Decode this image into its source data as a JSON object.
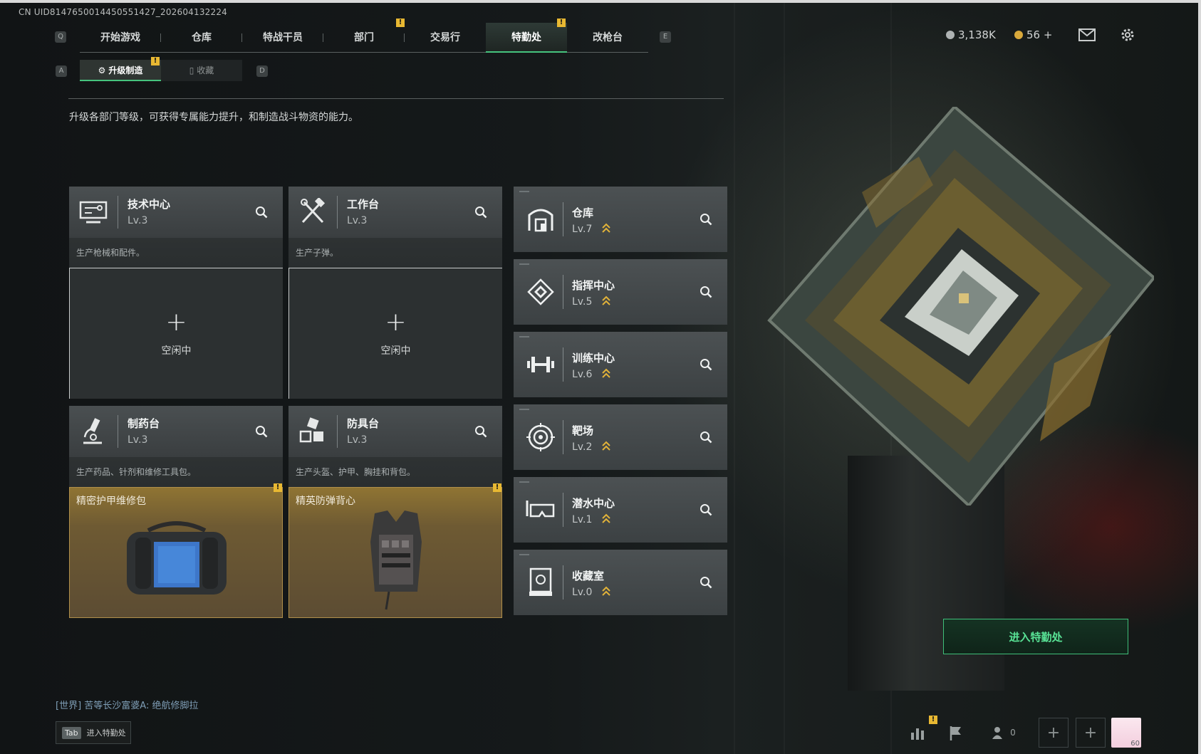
{
  "uid": "CN UID8147650014450551427_202604132224",
  "nav": {
    "key_left": "Q",
    "key_right": "E",
    "tabs": [
      "开始游戏",
      "仓库",
      "特战干员",
      "部门",
      "交易行",
      "特勤处",
      "改枪台"
    ],
    "active_tab": "特勤处",
    "badge": "!"
  },
  "currency": {
    "silver": "3,138K",
    "gold": "56 +"
  },
  "subnav": {
    "key_left": "A",
    "key_right": "D",
    "tabs": [
      "升级制造",
      "收藏"
    ],
    "active": "升级制造"
  },
  "intro": "升级各部门等级，可获得专属能力提升，和制造战斗物资的能力。",
  "cards": [
    {
      "title": "技术中心",
      "level": "Lv.3",
      "desc": "生产枪械和配件。",
      "status": "空闲中",
      "icon": "monitor-icon"
    },
    {
      "title": "工作台",
      "level": "Lv.3",
      "desc": "生产子弹。",
      "status": "空闲中",
      "icon": "tools-icon"
    },
    {
      "title": "制药台",
      "level": "Lv.3",
      "desc": "生产药品、针剂和维修工具包。",
      "item": "精密护甲维修包",
      "icon": "microscope-icon"
    },
    {
      "title": "防具台",
      "level": "Lv.3",
      "desc": "生产头盔、护甲、胸挂和背包。",
      "item": "精英防弹背心",
      "icon": "cubes-icon"
    }
  ],
  "plus_symbol": "+",
  "departments": [
    {
      "name": "仓库",
      "level": "Lv.7",
      "icon": "warehouse-icon"
    },
    {
      "name": "指挥中心",
      "level": "Lv.5",
      "icon": "chip-icon"
    },
    {
      "name": "训练中心",
      "level": "Lv.6",
      "icon": "dumbbell-icon"
    },
    {
      "name": "靶场",
      "level": "Lv.2",
      "icon": "target-icon"
    },
    {
      "name": "潜水中心",
      "level": "Lv.1",
      "icon": "goggles-icon"
    },
    {
      "name": "收藏室",
      "level": "Lv.0",
      "icon": "display-case-icon"
    }
  ],
  "enter_button": "进入特勤处",
  "chat": "[世界] 苦等长沙富婆A: 绝航修脚拉",
  "tab_hint": {
    "key": "Tab",
    "label": "进入特勤处"
  },
  "bottom": {
    "friends_count": "0",
    "avatar_level": "60"
  },
  "colors": {
    "accent_green": "#46c47e",
    "badge_yellow": "#e8b832",
    "item_gold": "#8f7433"
  }
}
